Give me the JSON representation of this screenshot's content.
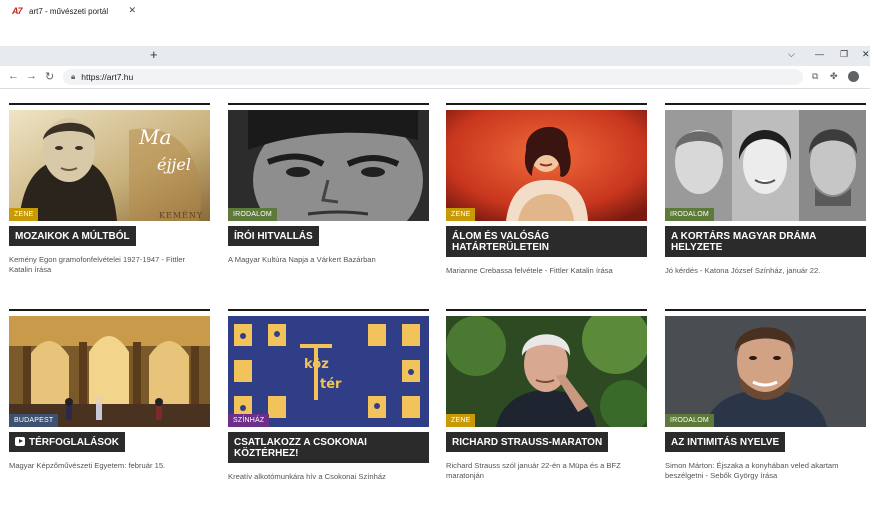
{
  "browser": {
    "favicon_text": "A7",
    "tab_title": "art7 - művészeti portál",
    "url": "https://art7.hu"
  },
  "colors": {
    "zene": "#c79a06",
    "irodalom": "#5d7a3a",
    "budapest": "#3d5270",
    "szinhaz": "#6e2f8a",
    "headline_bg": "#2b2b2b"
  },
  "cards": [
    {
      "category": "ZENE",
      "title": "MOZAIKOK A MÚLTBÓL",
      "subtitle": "Kemény Egon gramofonfelvételei 1927-1947 - Fittler Katalin írása",
      "image_text_1": "Ma",
      "image_text_2": "éjjel",
      "image_text_3": "KEMÉNY"
    },
    {
      "category": "IRODALOM",
      "title": "ÍRÓI HITVALLÁS",
      "subtitle": "A Magyar Kultúra Napja a Várkert Bazárban"
    },
    {
      "category": "ZENE",
      "title": "ÁLOM ÉS VALÓSÁG HATÁRTERÜLETEIN",
      "subtitle": "Marianne Crebassa felvétele - Fittler Katalin írása"
    },
    {
      "category": "IRODALOM",
      "title": "A KORTÁRS MAGYAR DRÁMA HELYZETE",
      "subtitle": "Jó kérdés - Katona József Színház, január 22."
    },
    {
      "category": "BUDAPEST",
      "title": "TÉRFOGLALÁSOK",
      "subtitle": "Magyar Képzőművészeti Egyetem: február 15."
    },
    {
      "category": "SZÍNHÁZ",
      "title": "CSATLAKOZZ A CSOKONAI KÖZTÉRHEZ!",
      "subtitle": "Kreatív alkotómunkára hív a Csokonai Színház",
      "image_text_1": "köz",
      "image_text_2": "tér"
    },
    {
      "category": "ZENE",
      "title": "RICHARD STRAUSS-MARATON",
      "subtitle": "Richard Strauss szól január 22-én a Müpa és a BFZ maratonján"
    },
    {
      "category": "IRODALOM",
      "title": "AZ INTIMITÁS NYELVE",
      "subtitle": "Simon Márton: Éjszaka a konyhában veled akartam beszélgetni - Sebők György írása"
    }
  ]
}
